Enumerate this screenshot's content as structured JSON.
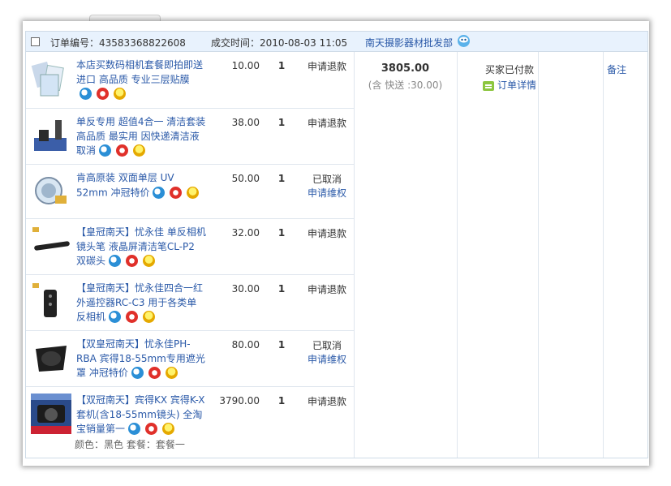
{
  "header": {
    "order_no_label": "订单编号：",
    "order_no": "43583368822608",
    "deal_time_label": "成交时间：",
    "deal_time": "2010-08-03 11:05",
    "shop_name": "南天摄影器材批发部"
  },
  "items": [
    {
      "title": "本店买数码相机套餐即拍即送进口 高品质 专业三层贴膜",
      "price": "10.00",
      "qty": "1",
      "status": "申请退款",
      "status_link": ""
    },
    {
      "title": "单反专用 超值4合一 清洁套装 高品质 最实用 因快递清洁液取消",
      "price": "38.00",
      "qty": "1",
      "status": "申请退款",
      "status_link": ""
    },
    {
      "title": "肯高原装 双面单层 UV 52mm 冲冠特价",
      "price": "50.00",
      "qty": "1",
      "status": "已取消",
      "status_link": "申请维权"
    },
    {
      "title": "【皇冠南天】忧永佳 单反相机镜头笔 液晶屏清洁笔CL-P2 双碳头",
      "price": "32.00",
      "qty": "1",
      "status": "申请退款",
      "status_link": ""
    },
    {
      "title": "【皇冠南天】忧永佳四合一红外遥控器RC-C3 用于各类单反相机",
      "price": "30.00",
      "qty": "1",
      "status": "申请退款",
      "status_link": ""
    },
    {
      "title": "【双皇冠南天】忧永佳PH-RBA 宾得18-55mm专用遮光罩 冲冠特价",
      "price": "80.00",
      "qty": "1",
      "status": "已取消",
      "status_link": "申请维权"
    },
    {
      "title": "【双冠南天】宾得KX 宾得K-X套机(含18-55mm镜头) 全淘宝销量第一",
      "price": "3790.00",
      "qty": "1",
      "status": "申请退款",
      "status_link": "",
      "variant": "颜色：黑色    套餐：套餐一"
    }
  ],
  "total": {
    "amount": "3805.00",
    "shipping": "(含 快送 :30.00)"
  },
  "pay_status": {
    "label": "买家已付款",
    "detail_link": "订单详情"
  },
  "remark": "备注"
}
